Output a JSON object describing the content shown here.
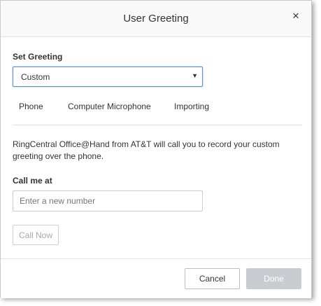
{
  "dialog": {
    "title": "User Greeting",
    "close_glyph": "×"
  },
  "greeting": {
    "label": "Set Greeting",
    "selected": "Custom",
    "caret_glyph": "▼"
  },
  "tabs": [
    {
      "label": "Phone",
      "active": true
    },
    {
      "label": "Computer Microphone",
      "active": false
    },
    {
      "label": "Importing",
      "active": false
    }
  ],
  "phone": {
    "description": "RingCentral Office@Hand from AT&T will call you to record your custom greeting over the phone.",
    "call_label": "Call me at",
    "number_value": "",
    "number_placeholder": "Enter a new number",
    "call_now_label": "Call Now"
  },
  "footer": {
    "cancel_label": "Cancel",
    "done_label": "Done"
  },
  "colors": {
    "select_border": "#5a8fd4",
    "done_disabled_bg": "#c9ccd1",
    "header_bg": "#f9f9f9"
  }
}
